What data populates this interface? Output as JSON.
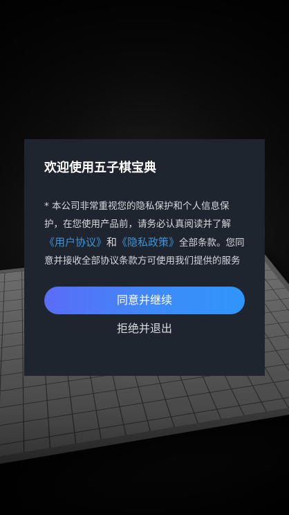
{
  "dialog": {
    "title": "欢迎使用五子棋宝典",
    "body_prefix": "* 本公司非常重视您的隐私保护和个人信息保护，在您使用产品前，请务必认真阅读并了解",
    "user_agreement_link": "《用户协议》",
    "conjunction": "和",
    "privacy_policy_link": "《隐私政策》",
    "body_suffix_1": "全部条款。",
    "body_suffix_2": "您同意并接收全部协议条款方可使用我们提供的服务",
    "agree_label": "同意并继续",
    "decline_label": "拒绝并退出"
  },
  "colors": {
    "dialog_bg": "#1e252e",
    "link": "#3e94d8",
    "button_gradient_start": "#5a6cf7",
    "button_gradient_end": "#2f95f8"
  }
}
